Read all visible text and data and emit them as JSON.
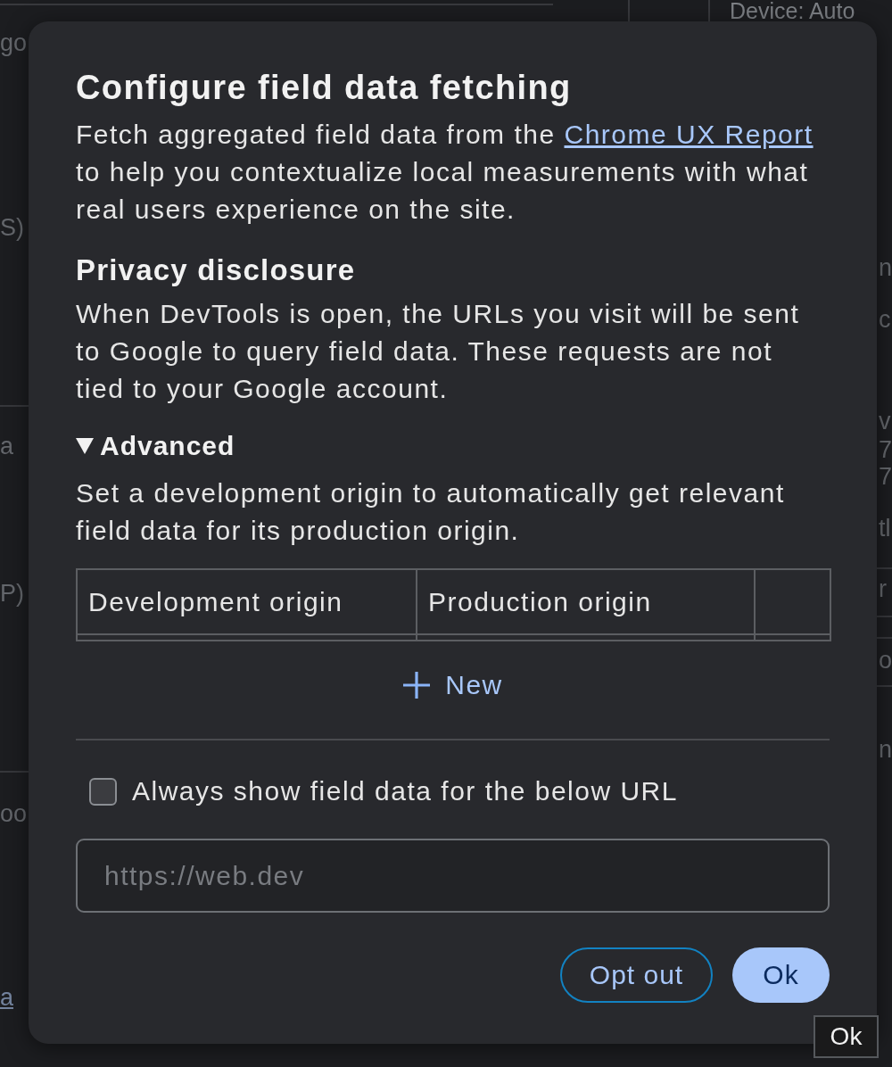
{
  "background": {
    "left_fragments": [
      {
        "text": "go",
        "kind": "text"
      },
      {
        "text": "S)",
        "kind": "text"
      },
      {
        "text": "a",
        "kind": "text"
      },
      {
        "text": "P)",
        "kind": "text"
      },
      {
        "text": "oo",
        "kind": "text"
      },
      {
        "text": "a",
        "kind": "link"
      }
    ],
    "device_label": "Device: Auto",
    "right_fragments": [
      "n",
      "c",
      "v",
      "7",
      "7",
      "tl",
      "r",
      "o",
      "n"
    ]
  },
  "dialog": {
    "title": "Configure field data fetching",
    "intro": {
      "before": "Fetch aggregated field data from the",
      "link": "Chrome UX Report",
      "after": "to help you contextualize local measurements with what real users experience on the site."
    },
    "privacy": {
      "heading": "Privacy disclosure",
      "text": "When DevTools is open, the URLs you visit will be sent to Google to query field data. These requests are not tied to your Google account."
    },
    "advanced": {
      "label": "Advanced",
      "expanded": true,
      "text": "Set a development origin to automatically get relevant field data for its production origin.",
      "table": {
        "columns": [
          "Development origin",
          "Production origin"
        ]
      },
      "new_button": "New"
    },
    "url_override": {
      "label": "Always show field data for the below URL",
      "checked": false,
      "placeholder": "https://web.dev"
    },
    "buttons": [
      {
        "label": "Opt out",
        "kind": "outlined"
      },
      {
        "label": "Ok",
        "kind": "filled"
      }
    ]
  },
  "tooltip": {
    "text": "Ok"
  }
}
